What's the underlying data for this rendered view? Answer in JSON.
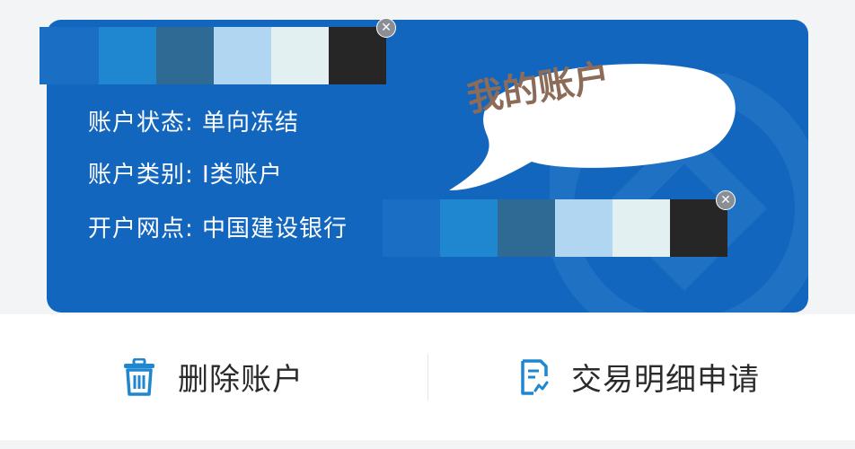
{
  "card": {
    "status": "账户状态: 单向冻结",
    "type": "账户类别: Ⅰ类账户",
    "branch": "开户网点: 中国建设银行"
  },
  "bubble": {
    "label": "我的账户"
  },
  "mosaic": {
    "colors": [
      "#1a6fc4",
      "#1f86d0",
      "#2f6a94",
      "#b1d6f1",
      "#e3f0f2",
      "#262626"
    ],
    "close_icon": "close-icon"
  },
  "actions": {
    "delete_label": "删除账户",
    "detail_label": "交易明细申请",
    "delete_icon": "trash-icon",
    "detail_icon": "document-icon"
  },
  "colors": {
    "card_blue": "#1366be",
    "bubble_text": "#8c6c58",
    "icon_blue": "#1f86d0"
  }
}
